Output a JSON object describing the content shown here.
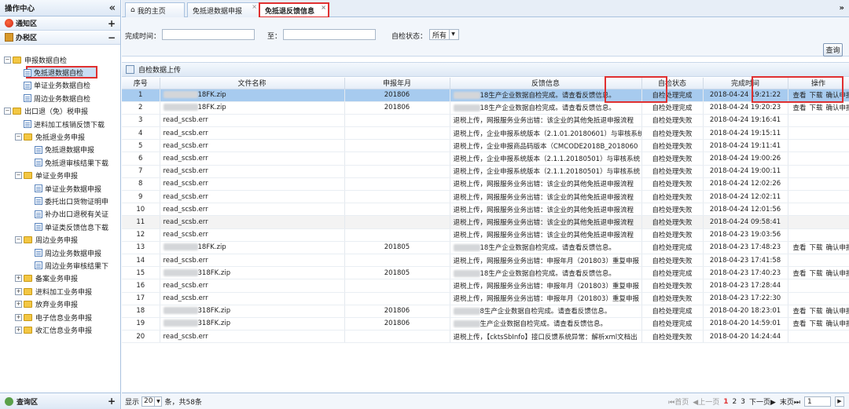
{
  "left": {
    "title": "操作中心",
    "collapse": "«",
    "notice": "通知区",
    "notice_ctl": "+",
    "office": "办税区",
    "office_ctl": "−",
    "footer": "查询区",
    "footer_ctl": "+",
    "tree": [
      {
        "l": 0,
        "t": "−",
        "k": "f",
        "label": "申报数据自检"
      },
      {
        "l": 1,
        "k": "d",
        "label": "免抵退数据自检",
        "sel": true
      },
      {
        "l": 1,
        "k": "d",
        "label": "单证业务数据自检"
      },
      {
        "l": 1,
        "k": "d",
        "label": "周边业务数据自检"
      },
      {
        "l": 0,
        "t": "−",
        "k": "f",
        "label": "出口退（免）税申报"
      },
      {
        "l": 1,
        "k": "d",
        "label": "进料加工核销反馈下载"
      },
      {
        "l": 1,
        "t": "−",
        "k": "f",
        "label": "免抵退业务申报"
      },
      {
        "l": 2,
        "k": "d",
        "label": "免抵退数据申报"
      },
      {
        "l": 2,
        "k": "d",
        "label": "免抵退审核结果下载"
      },
      {
        "l": 1,
        "t": "−",
        "k": "f",
        "label": "单证业务申报"
      },
      {
        "l": 2,
        "k": "d",
        "label": "单证业务数据申报"
      },
      {
        "l": 2,
        "k": "d",
        "label": "委托出口货物证明申"
      },
      {
        "l": 2,
        "k": "d",
        "label": "补办出口退税有关证"
      },
      {
        "l": 2,
        "k": "d",
        "label": "单证类反馈信息下载"
      },
      {
        "l": 1,
        "t": "−",
        "k": "f",
        "label": "周边业务申报"
      },
      {
        "l": 2,
        "k": "d",
        "label": "周边业务数据申报"
      },
      {
        "l": 2,
        "k": "d",
        "label": "周边业务审核结果下"
      },
      {
        "l": 1,
        "t": "+",
        "k": "f",
        "label": "备案业务申报"
      },
      {
        "l": 1,
        "t": "+",
        "k": "f",
        "label": "进料加工业务申报"
      },
      {
        "l": 1,
        "t": "+",
        "k": "f",
        "label": "放弃业务申报"
      },
      {
        "l": 1,
        "t": "+",
        "k": "f",
        "label": "电子信息业务申报"
      },
      {
        "l": 1,
        "t": "+",
        "k": "f",
        "label": "收汇信息业务申报"
      }
    ]
  },
  "tabs": [
    {
      "label": "我的主页"
    },
    {
      "label": "免抵退数据申报"
    },
    {
      "label": "免抵退反馈信息"
    }
  ],
  "tabs_more": "»",
  "query": {
    "date_label": "完成时间：",
    "to_label": "至：",
    "status_label": "自检状态：",
    "status_value": "所有",
    "search_btn": "查询"
  },
  "grid_title": "自检数据上传",
  "columns": [
    "序号",
    "文件名称",
    "申报年月",
    "反馈信息",
    "自检状态",
    "完成时间",
    "操作"
  ],
  "actions": {
    "view": "查看",
    "download": "下载",
    "confirm": "确认申报"
  },
  "rows": [
    {
      "no": "1",
      "file": "18FK.zip",
      "blur": true,
      "ym": "201806",
      "fb": "18生产企业数据自检完成。请查看反馈信息。",
      "fbblur": true,
      "st": "自检处理完成",
      "time": "2018-04-24 19:21:22",
      "ops": true
    },
    {
      "no": "2",
      "file": "18FK.zip",
      "blur": true,
      "ym": "201806",
      "fb": "18生产企业数据自检完成。请查看反馈信息。",
      "fbblur": true,
      "st": "自检处理完成",
      "time": "2018-04-24 19:20:23",
      "ops": true
    },
    {
      "no": "3",
      "file": "read_scsb.err",
      "ym": "",
      "fb": "退税上传，网报服务业务出错：该企业的其他免抵退申报流程",
      "st": "自检处理失败",
      "time": "2018-04-24 19:16:41"
    },
    {
      "no": "4",
      "file": "read_scsb.err",
      "ym": "",
      "fb": "退税上传，企业申报系统版本（2.1.01.20180601）与审核系统",
      "st": "自检处理失败",
      "time": "2018-04-24 19:15:11"
    },
    {
      "no": "5",
      "file": "read_scsb.err",
      "ym": "",
      "fb": "退税上传，企业申报商品码版本（CMCODE2018B_2018060",
      "st": "自检处理失败",
      "time": "2018-04-24 19:11:41"
    },
    {
      "no": "6",
      "file": "read_scsb.err",
      "ym": "",
      "fb": "退税上传，企业申报系统版本（2.1.1.20180501）与审核系统",
      "st": "自检处理失败",
      "time": "2018-04-24 19:00:26"
    },
    {
      "no": "7",
      "file": "read_scsb.err",
      "ym": "",
      "fb": "退税上传，企业申报系统版本（2.1.1.20180501）与审核系统",
      "st": "自检处理失败",
      "time": "2018-04-24 19:00:11"
    },
    {
      "no": "8",
      "file": "read_scsb.err",
      "ym": "",
      "fb": "退税上传，网报服务业务出错：该企业的其他免抵退申报流程",
      "st": "自检处理失败",
      "time": "2018-04-24 12:02:26"
    },
    {
      "no": "9",
      "file": "read_scsb.err",
      "ym": "",
      "fb": "退税上传，网报服务业务出错：该企业的其他免抵退申报流程",
      "st": "自检处理失败",
      "time": "2018-04-24 12:02:11"
    },
    {
      "no": "10",
      "file": "read_scsb.err",
      "ym": "",
      "fb": "退税上传，网报服务业务出错：该企业的其他免抵退申报流程",
      "st": "自检处理失败",
      "time": "2018-04-24 12:01:56"
    },
    {
      "no": "11",
      "file": "read_scsb.err",
      "ym": "",
      "fb": "退税上传，网报服务业务出错：该企业的其他免抵退申报流程",
      "st": "自检处理失败",
      "time": "2018-04-24 09:58:41",
      "alt": true
    },
    {
      "no": "12",
      "file": "read_scsb.err",
      "ym": "",
      "fb": "退税上传，网报服务业务出错：该企业的其他免抵退申报流程",
      "st": "自检处理失败",
      "time": "2018-04-23 19:03:56"
    },
    {
      "no": "13",
      "file": "18FK.zip",
      "blur": true,
      "ym": "201805",
      "fb": "18生产企业数据自检完成。请查看反馈信息。",
      "fbblur": true,
      "st": "自检处理完成",
      "time": "2018-04-23 17:48:23",
      "ops": true
    },
    {
      "no": "14",
      "file": "read_scsb.err",
      "ym": "",
      "fb": "退税上传，网报服务业务出错：申报年月（201803）重复申报",
      "st": "自检处理失败",
      "time": "2018-04-23 17:41:58"
    },
    {
      "no": "15",
      "file": "318FK.zip",
      "blur": true,
      "ym": "201805",
      "fb": "18生产企业数据自检完成。请查看反馈信息。",
      "fbblur": true,
      "st": "自检处理完成",
      "time": "2018-04-23 17:40:23",
      "ops": true
    },
    {
      "no": "16",
      "file": "read_scsb.err",
      "ym": "",
      "fb": "退税上传，网报服务业务出错：申报年月（201803）重复申报",
      "st": "自检处理失败",
      "time": "2018-04-23 17:28:44"
    },
    {
      "no": "17",
      "file": "read_scsb.err",
      "ym": "",
      "fb": "退税上传，网报服务业务出错：申报年月（201803）重复申报",
      "st": "自检处理失败",
      "time": "2018-04-23 17:22:30"
    },
    {
      "no": "18",
      "file": "318FK.zip",
      "blur": true,
      "ym": "201806",
      "fb": "8生产企业数据自检完成。请查看反馈信息。",
      "fbblur": true,
      "st": "自检处理完成",
      "time": "2018-04-20 18:23:01",
      "ops": true
    },
    {
      "no": "19",
      "file": "318FK.zip",
      "blur": true,
      "ym": "201806",
      "fb": "生产企业数据自检完成。请查看反馈信息。",
      "fbblur": true,
      "st": "自检处理完成",
      "time": "2018-04-20 14:59:01",
      "ops": true
    },
    {
      "no": "20",
      "file": "read_scsb.err",
      "ym": "",
      "fb": "退税上传，【cktsSbInfo】接口反馈系统异常：解析xml文档出",
      "st": "自检处理失败",
      "time": "2018-04-20 14:24:44"
    }
  ],
  "footer": {
    "show": "显示",
    "page_size": "20",
    "suffix": "条，共58条",
    "first": "首页",
    "prev": "上一页",
    "pages": [
      "1",
      "2",
      "3"
    ],
    "next": "下一页",
    "last": "末页",
    "page_input": "1"
  }
}
